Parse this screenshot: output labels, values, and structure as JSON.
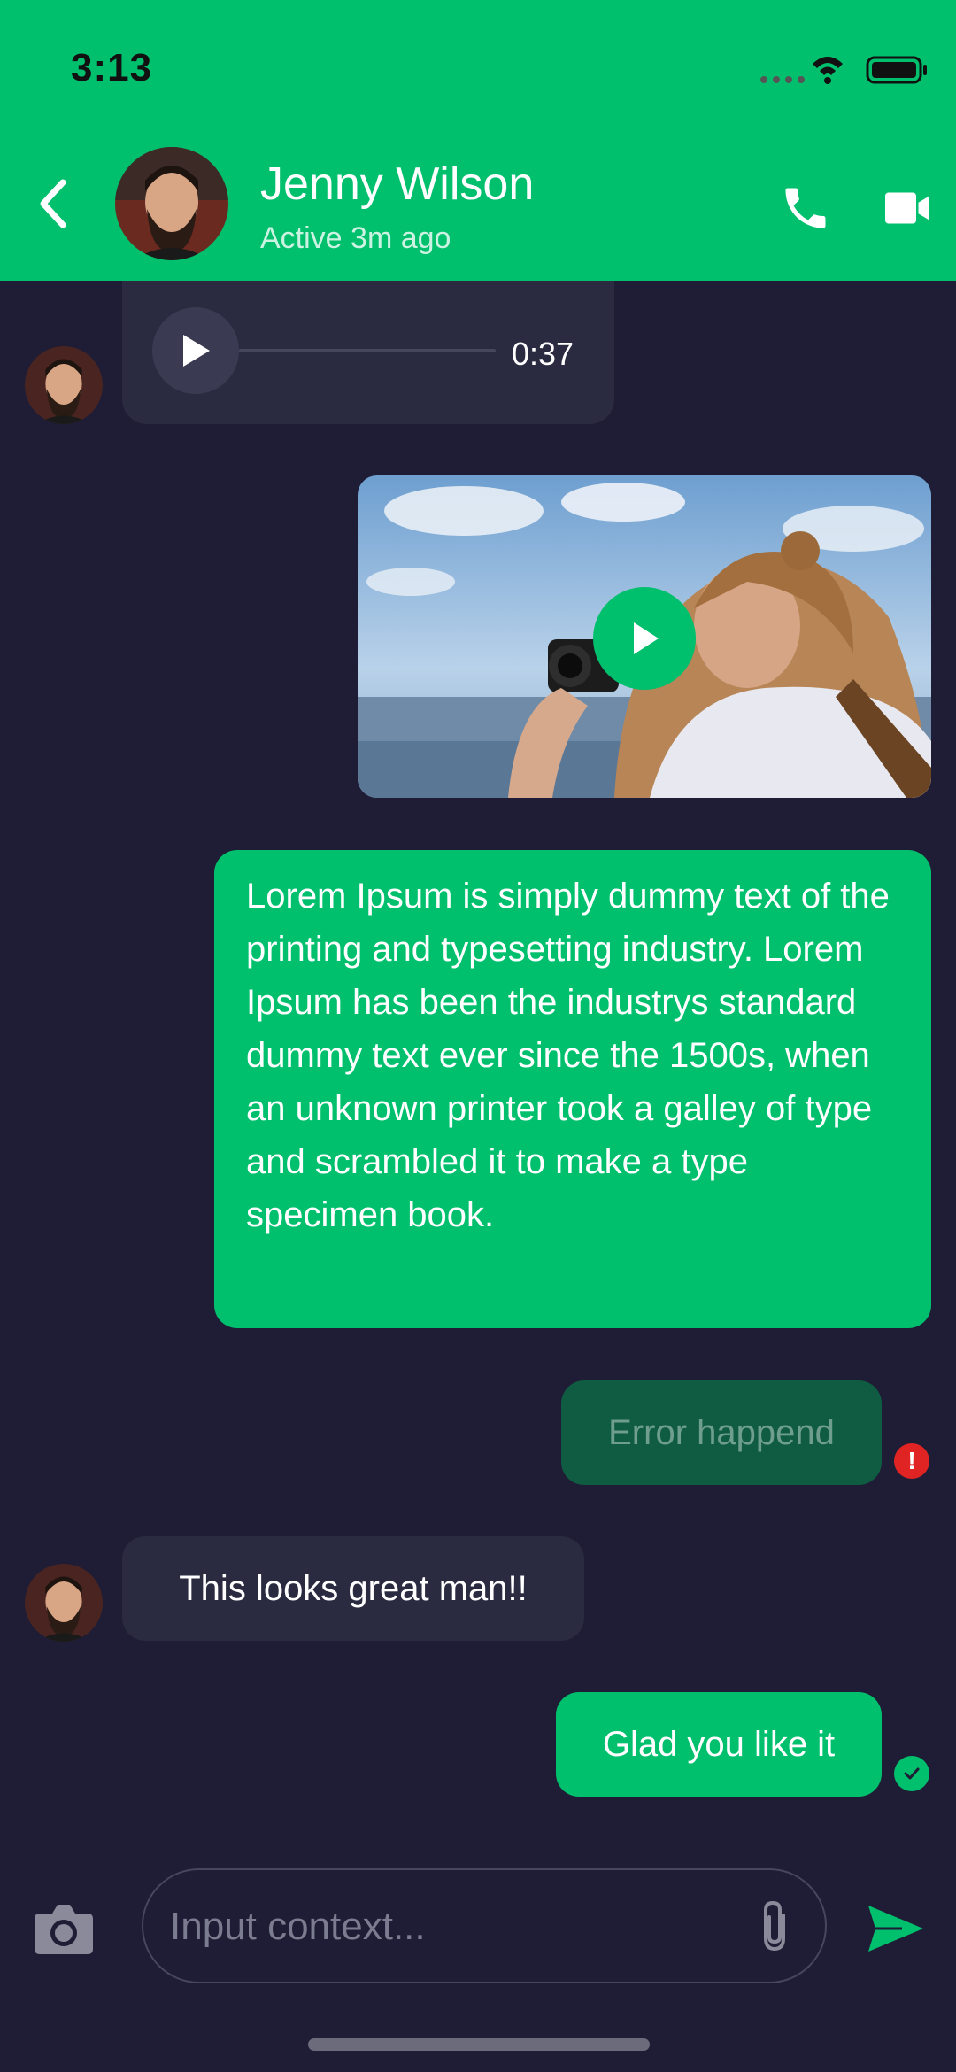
{
  "status_bar": {
    "time": "3:13"
  },
  "header": {
    "contact_name": "Jenny Wilson",
    "contact_status": "Active 3m ago",
    "icons": {
      "back": "back-chevron-icon",
      "call": "phone-icon",
      "video": "video-camera-icon"
    }
  },
  "messages": {
    "audio": {
      "duration": "0:37",
      "progress": 0
    },
    "long_text": "Lorem Ipsum is simply dummy text of the printing and typesetting industry. Lorem Ipsum has been the industrys standard dummy text ever since the 1500s, when an unknown printer took a galley of type and scrambled it to make a type specimen book.",
    "error_text": "Error happend",
    "received_text": "This looks great man!!",
    "sent_text": "Glad you like it"
  },
  "composer": {
    "placeholder": "Input context..."
  },
  "colors": {
    "primary": "#00BF6D",
    "background": "#1E1D35",
    "received_bubble": "#2A2A40",
    "error_bubble": "#0F5C43",
    "error_red": "#E02424"
  }
}
